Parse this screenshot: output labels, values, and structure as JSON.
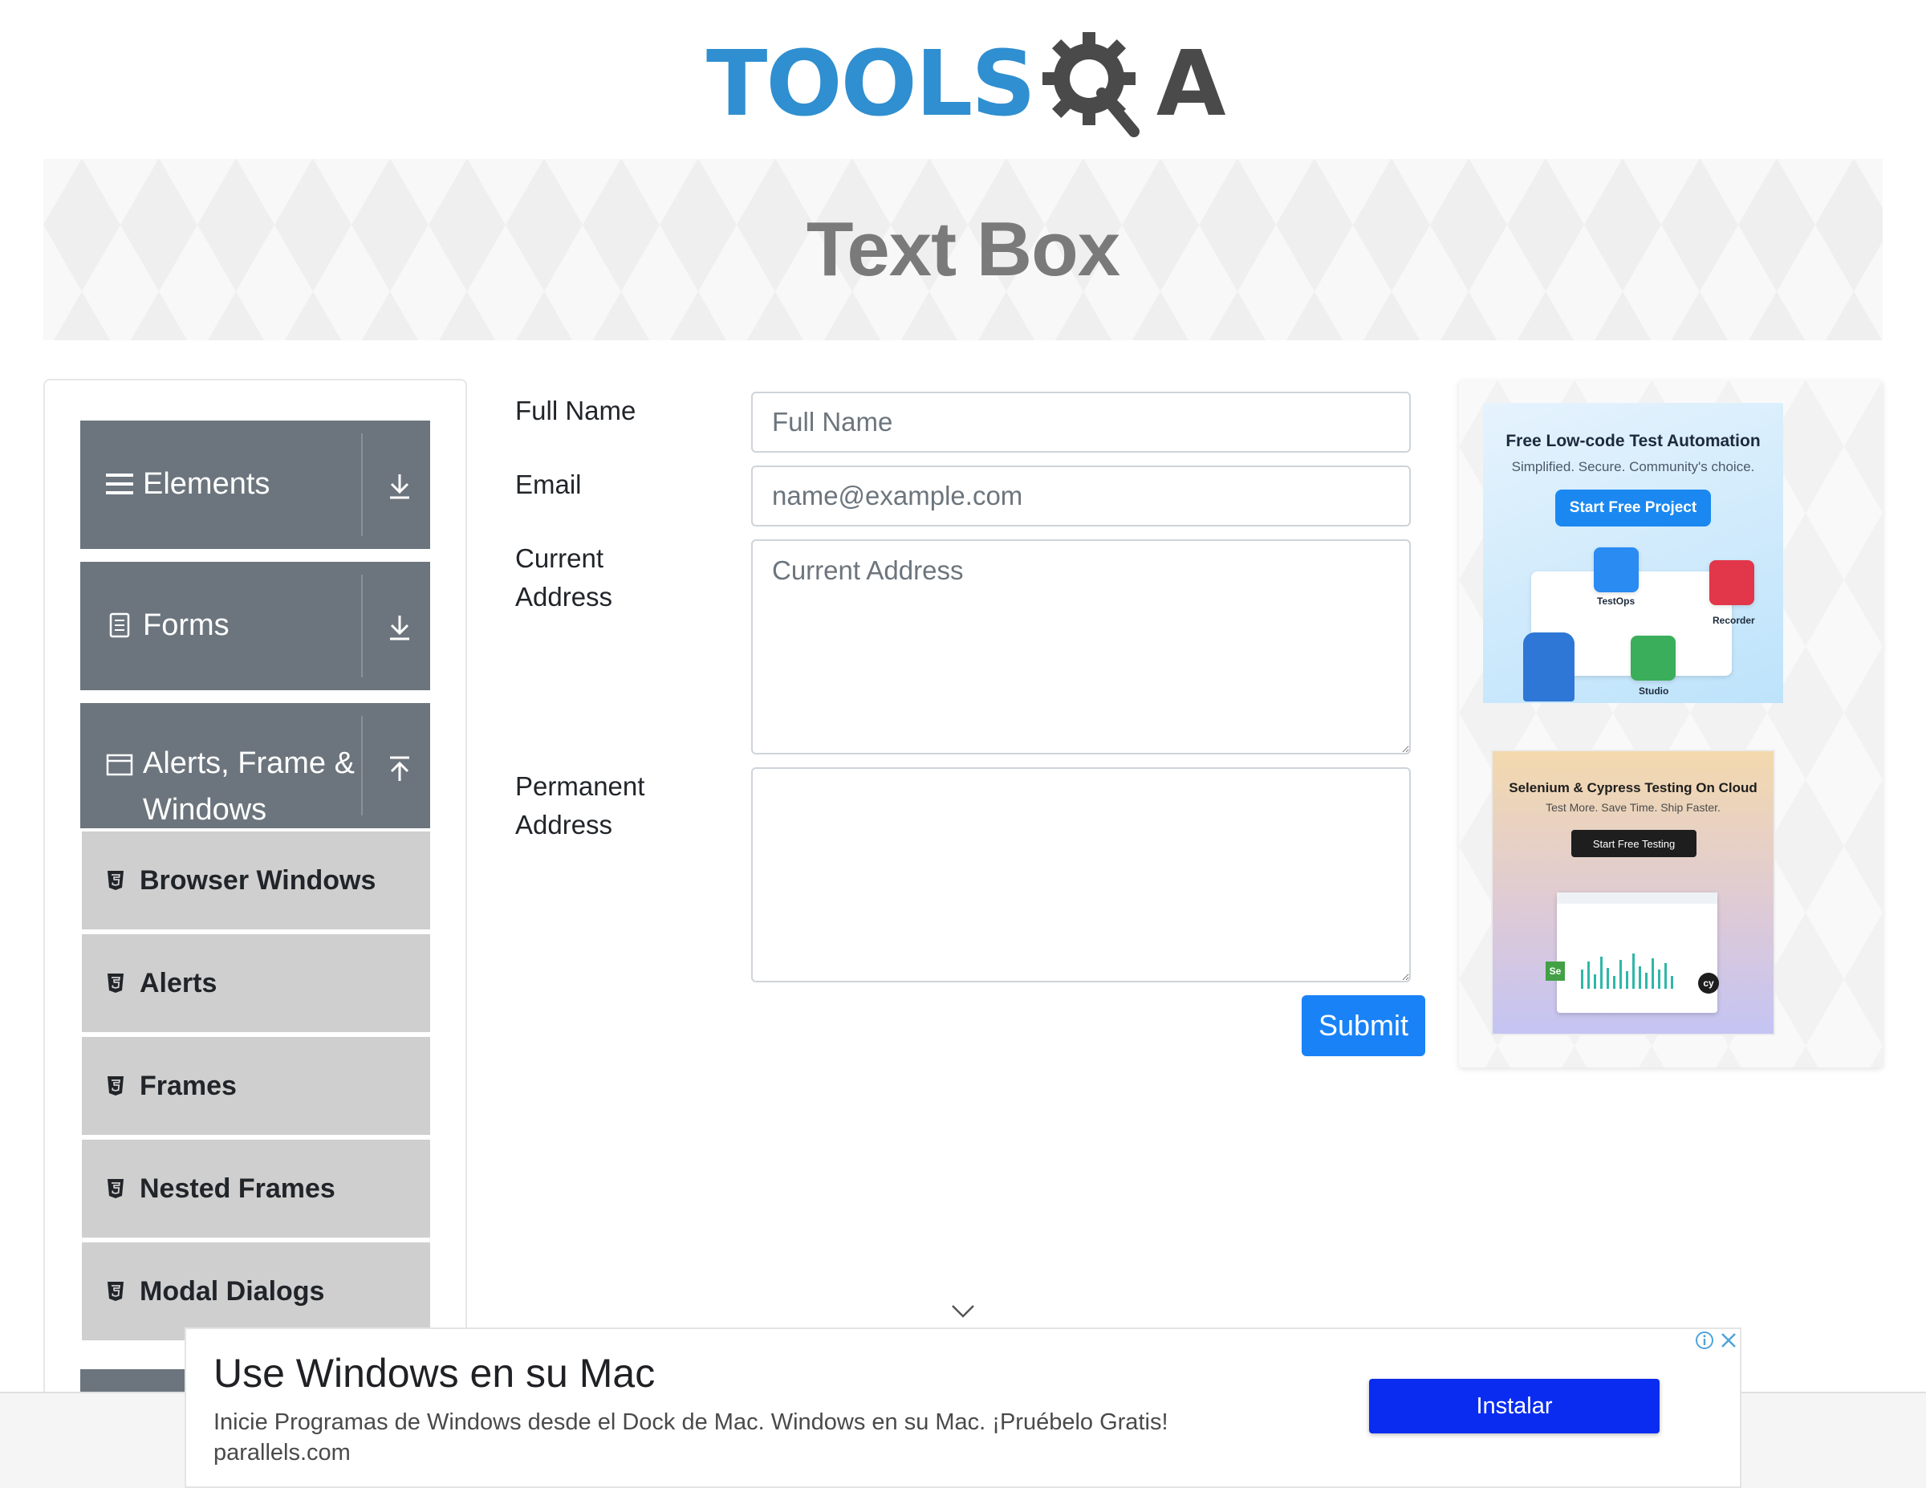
{
  "header": {
    "logo_text_tools": "TOOLS",
    "logo_text_qa": "A"
  },
  "banner": {
    "title": "Text Box"
  },
  "sidebar": {
    "groups": [
      {
        "label": "Elements",
        "icon": "hamburger-icon",
        "toggle_icon": "download-arrow-icon"
      },
      {
        "label": "Forms",
        "icon": "document-icon",
        "toggle_icon": "download-arrow-icon"
      },
      {
        "label_line1": "Alerts, Frame &",
        "label_line2": "Windows",
        "icon": "window-icon",
        "toggle_icon": "upload-arrow-icon"
      }
    ],
    "sub_items": [
      {
        "label": "Browser Windows",
        "icon": "html5-icon"
      },
      {
        "label": "Alerts",
        "icon": "html5-icon"
      },
      {
        "label": "Frames",
        "icon": "html5-icon"
      },
      {
        "label": "Nested Frames",
        "icon": "html5-icon"
      },
      {
        "label": "Modal Dialogs",
        "icon": "html5-icon"
      }
    ]
  },
  "form": {
    "full_name_label": "Full Name",
    "full_name_placeholder": "Full Name",
    "email_label": "Email",
    "email_placeholder": "name@example.com",
    "current_address_label_line1": "Current",
    "current_address_label_line2": "Address",
    "current_address_placeholder": "Current Address",
    "permanent_address_label_line1": "Permanent",
    "permanent_address_label_line2": "Address",
    "permanent_address_value": "",
    "submit_label": "Submit"
  },
  "ads": {
    "ad1": {
      "title": "Free Low-code Test Automation",
      "subtitle": "Simplified. Secure. Community's choice.",
      "button": "Start Free Project",
      "labels": [
        "TestOps",
        "Recorder",
        "Studio"
      ]
    },
    "ad2": {
      "title": "Selenium & Cypress Testing On Cloud",
      "subtitle": "Test More. Save Time. Ship Faster.",
      "button": "Start Free Testing"
    }
  },
  "bottom_ad": {
    "title": "Use Windows en su Mac",
    "description": "Inicie Programas de Windows desde el Dock de Mac. Windows en su Mac. ¡Pruébelo Gratis!",
    "domain": "parallels.com",
    "button": "Instalar"
  },
  "colors": {
    "sidebar_group_bg": "#6c757d",
    "sidebar_sub_bg": "#cfcfcf",
    "submit_bg": "#1a82f7",
    "install_bg": "#0a2cf0",
    "logo_blue": "#2f8fd0"
  }
}
